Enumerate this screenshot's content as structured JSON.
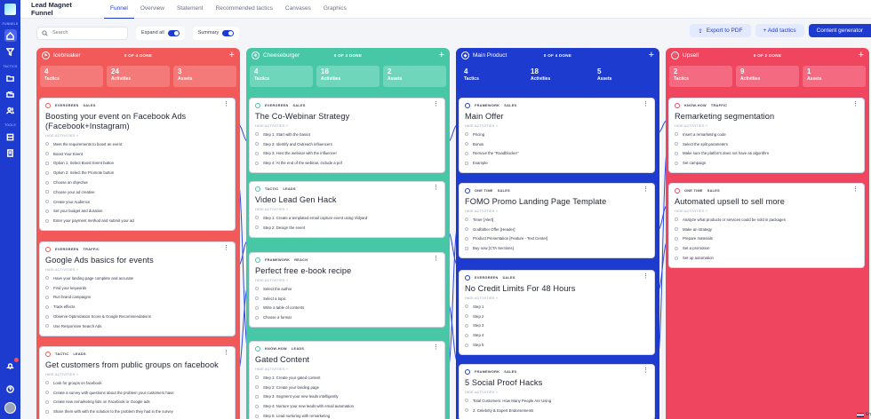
{
  "app": {
    "title": "Lead Magnet Funnel"
  },
  "tabs": [
    {
      "label": "Funnel",
      "active": true
    },
    {
      "label": "Overview"
    },
    {
      "label": "Statement"
    },
    {
      "label": "Recommended tactics"
    },
    {
      "label": "Canvases"
    },
    {
      "label": "Graphics"
    }
  ],
  "sidebar": {
    "section1": "FUNNELS",
    "section2": "TACTICS",
    "section3": "TOOLS"
  },
  "toolbar": {
    "search_placeholder": "Search",
    "expand_all": "Expand all",
    "summary": "Summary",
    "export_pdf": "Export to PDF",
    "add_tactics": "+ Add tactics",
    "content_generator": "Content generator"
  },
  "colors": {
    "red": "#f25a5a",
    "green": "#48c7a7",
    "blue": "#1e3bd0",
    "pink": "#f0455f"
  },
  "columns": [
    {
      "name": "Icebreaker",
      "done": "0 OF 4 DONE",
      "stats": [
        {
          "n": "4",
          "l": "Tactics"
        },
        {
          "n": "24",
          "l": "Activities"
        },
        {
          "n": "3",
          "l": "Assets"
        }
      ],
      "cards": [
        {
          "tags": [
            "EVERGREEN",
            "SALES"
          ],
          "title": "Boosting your event on Facebook Ads (Facebook+Instagram)",
          "hide": "HIDE ACTIVITIES",
          "activities": [
            "Meet the requirements to boost an event",
            "Boost Your Event",
            "Option 1: Select Boost Event button",
            "Option 2: Select the Promote button",
            "Choose an objective",
            "Choose your ad creative",
            "Create your Audience",
            "Set your budget and duration",
            "Enter your payment method and submit your ad"
          ]
        },
        {
          "tags": [
            "EVERGREEN",
            "TRAFFIC"
          ],
          "title": "Google Ads basics for events",
          "hide": "HIDE ACTIVITIES",
          "activities": [
            "Have your landing page complete and accurate",
            "Find your keywords",
            "Run brand campaigns",
            "Track effects",
            "Observe Optimization Score & Google Recommendations",
            "Use Responsive Search Ads"
          ]
        },
        {
          "tags": [
            "TACTIC",
            "LEADS"
          ],
          "title": "Get customers from public groups on facebook",
          "hide": "HIDE ACTIVITIES",
          "activities": [
            "Look for groups on facebook",
            "Create a survey with questions about the problem your customers have",
            "Create new remarketing lists on Facebook or Google ads",
            "Share them with with the solution to the problem they had in the survey"
          ]
        }
      ]
    },
    {
      "name": "Cheeseburger",
      "done": "0 OF 4 DONE",
      "stats": [
        {
          "n": "4",
          "l": "Tactics"
        },
        {
          "n": "16",
          "l": "Activities"
        },
        {
          "n": "2",
          "l": "Assets"
        }
      ],
      "cards": [
        {
          "tags": [
            "EVERGREEN",
            "SALES"
          ],
          "title": "The Co-Webinar Strategy",
          "hide": "HIDE ACTIVITIES",
          "activities": [
            "Step 1: Start with the basics",
            "Step 2: Identify and Outreach influencers",
            "Step 3: Host the webinar with the influencer",
            "Step 4: At the end of the webinar, include a pof"
          ]
        },
        {
          "tags": [
            "TACTIC",
            "LEADS"
          ],
          "title": "Video Lead Gen Hack",
          "hide": "HIDE ACTIVITIES",
          "activities": [
            "Step 1: Create a templated email capture event using Vidyard",
            "Step 2: Design the event"
          ]
        },
        {
          "tags": [
            "FRAMEWORK",
            "REACH"
          ],
          "title": "Perfect free e-book recipe",
          "hide": "HIDE ACTIVITIES",
          "activities": [
            "Select the author",
            "Select a topic",
            "Write a table of contents",
            "Choose a format"
          ]
        },
        {
          "tags": [
            "KNOW-HOW",
            "LEADS"
          ],
          "title": "Gated Content",
          "hide": "HIDE ACTIVITIES",
          "activities": [
            "Step 1: Create your gated content",
            "Step 2: Create your landing page",
            "Step 3: Segment your new leads intelligently",
            "Step 4: Nurture your new leads with email automation",
            "Step 5: Lead nurturing with remarketing"
          ]
        }
      ]
    },
    {
      "name": "Main Product",
      "done": "0 OF 4 DONE",
      "stats": [
        {
          "n": "4",
          "l": "Tactics"
        },
        {
          "n": "18",
          "l": "Activities"
        },
        {
          "n": "5",
          "l": "Assets"
        }
      ],
      "cards": [
        {
          "tags": [
            "FRAMEWORK",
            "SALES"
          ],
          "title": "Main Offer",
          "hide": "HIDE ACTIVITIES",
          "activities": [
            "Pricing",
            "Bonus",
            "Remove the \"Roadblocker\"",
            "Example"
          ]
        },
        {
          "tags": [
            "ONE TIME",
            "SALES"
          ],
          "title": "FOMO Promo Landing Page Template",
          "hide": "HIDE ACTIVITIES",
          "activities": [
            "Timer [Alert]",
            "Godfather Offer [Header]",
            "Product Presentation [Feature - Text Center]",
            "Buy now [CTA Sections]"
          ]
        },
        {
          "tags": [
            "EVERGREEN",
            "SALES"
          ],
          "title": "No Credit Limits For 48 Hours",
          "hide": "HIDE ACTIVITIES",
          "activities": [
            "Step 1",
            "Step 2",
            "Step 3",
            "Step 4",
            "Step 5"
          ]
        },
        {
          "tags": [
            "FRAMEWORK",
            "SALES"
          ],
          "title": "5 Social Proof Hacks",
          "hide": "HIDE ACTIVITIES",
          "activities": [
            "Total Customers: How Many People Are Using",
            "2. Celebrity & Expert Endorsements"
          ]
        }
      ]
    },
    {
      "name": "Upsell",
      "done": "0 OF 2 DONE",
      "stats": [
        {
          "n": "2",
          "l": "Tactics"
        },
        {
          "n": "9",
          "l": "Activities"
        },
        {
          "n": "1",
          "l": "Assets"
        }
      ],
      "cards": [
        {
          "tags": [
            "KNOW-HOW",
            "TRAFFIC"
          ],
          "title": "Remarketing segmentation",
          "hide": "HIDE ACTIVITIES",
          "activities": [
            "Insert a remarketing code",
            "Select the split parameters",
            "Make sure the platform does not have an algorithm",
            "Set campaign"
          ]
        },
        {
          "tags": [
            "ONE TIME",
            "SALES"
          ],
          "title": "Automated upsell to sell more",
          "hide": "HIDE ACTIVITIES",
          "activities": [
            "Analyze what products or services could be sold in packages",
            "Make an strategy",
            "Prepare materials",
            "Set a promotion",
            "Set up automation"
          ]
        }
      ]
    }
  ],
  "language": "En"
}
